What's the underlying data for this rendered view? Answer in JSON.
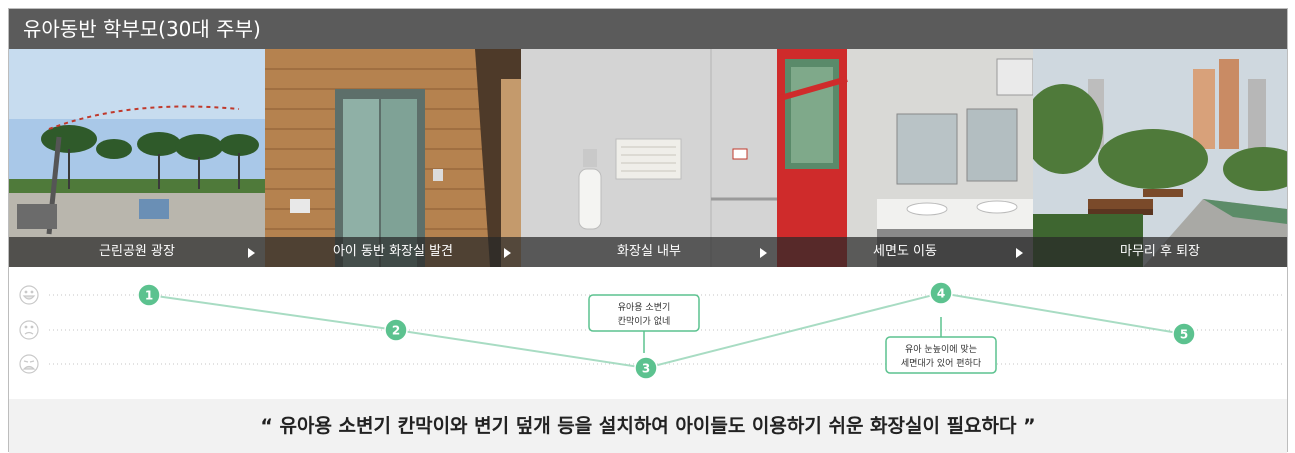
{
  "title": "유아동반 학부모(30대 주부)",
  "steps": [
    {
      "caption": "근린공원 광장"
    },
    {
      "caption": "아이 동반 화장실 발견"
    },
    {
      "caption": "화장실 내부"
    },
    {
      "caption": "세면도 이동"
    },
    {
      "caption": "마무리 후 퇴장"
    }
  ],
  "emotion_levels": [
    "happy",
    "neutral",
    "unhappy"
  ],
  "journey_points": [
    {
      "number": "1",
      "level": "happy"
    },
    {
      "number": "2",
      "level": "neutral"
    },
    {
      "number": "3",
      "level": "unhappy"
    },
    {
      "number": "4",
      "level": "happy"
    },
    {
      "number": "5",
      "level": "neutral"
    }
  ],
  "callouts": [
    {
      "point": "3",
      "lines": [
        "유아용 소변기",
        "칸막이가 없네"
      ]
    },
    {
      "point": "4",
      "lines": [
        "유아 눈높이에 맞는",
        "세면대가 있어 편하다"
      ]
    }
  ],
  "quote": "“ 유아용 소변기 칸막이와 변기 덮개 등을 설치하여 아이들도 이용하기 쉬운 화장실이 필요하다 ”",
  "colors": {
    "accent": "#5cc28f",
    "line": "#a8dcc3",
    "title_bg": "#5b5b5b"
  }
}
